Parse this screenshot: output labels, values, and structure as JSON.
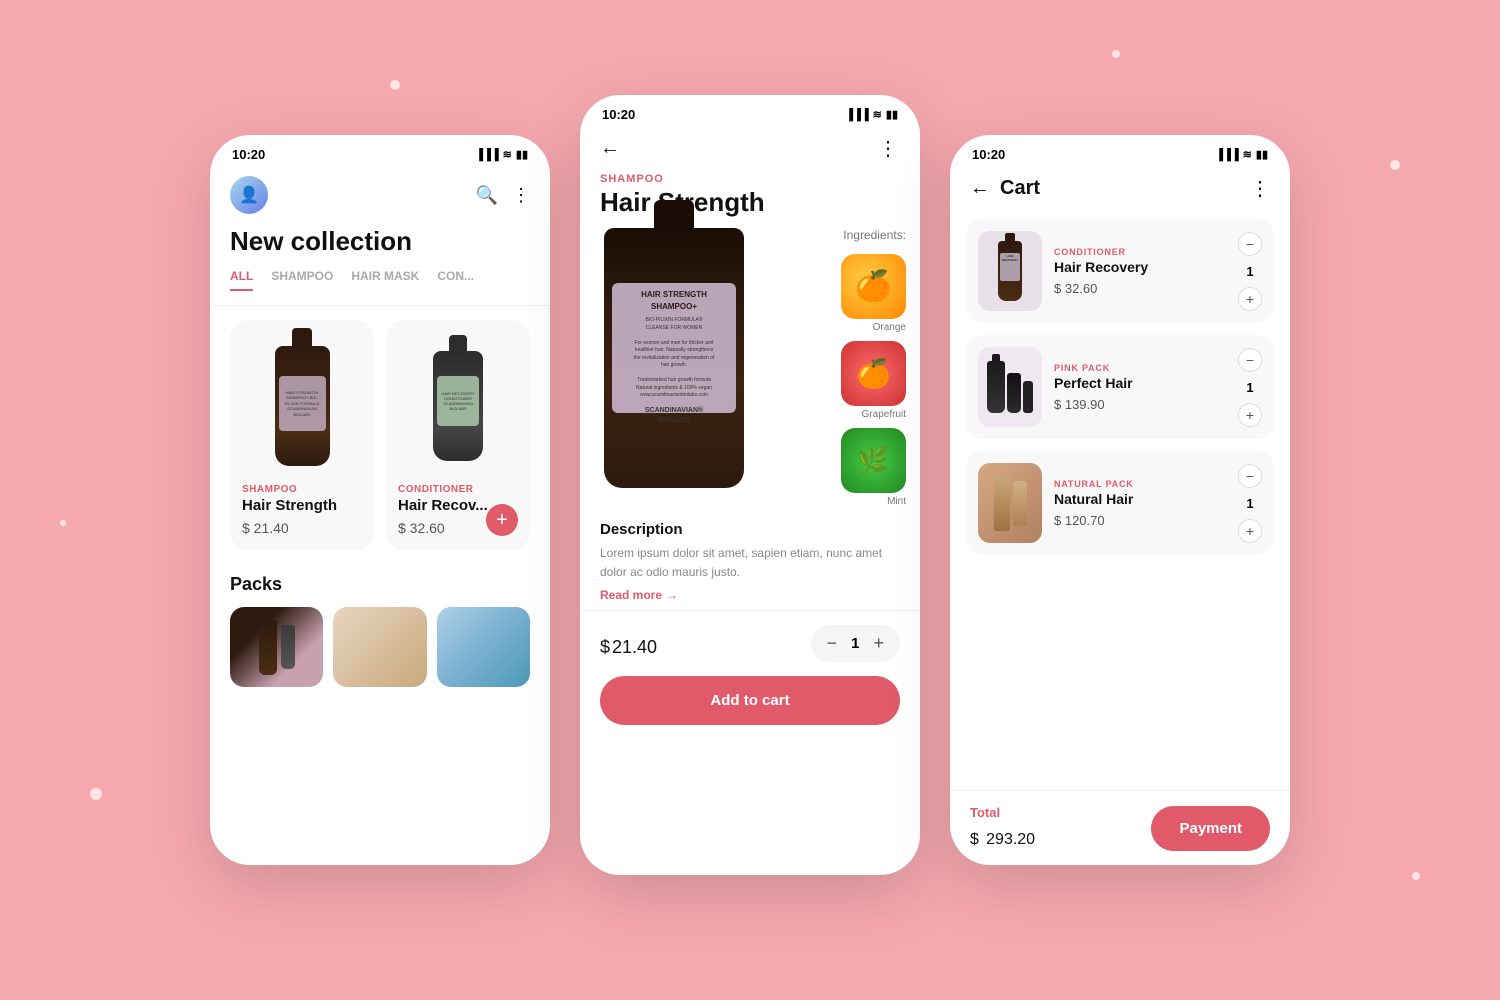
{
  "background": "#f5a8ae",
  "phones": {
    "left": {
      "status": {
        "time": "10:20",
        "icons": "▐▐▐ ≋ ▮▮"
      },
      "header": {
        "search_label": "🔍",
        "menu_label": "⋮"
      },
      "title": "New collection",
      "categories": [
        "ALL",
        "SHAMPOO",
        "HAIR MASK",
        "CON..."
      ],
      "active_category": "ALL",
      "products": [
        {
          "category": "SHAMPOO",
          "name": "Hair Strength",
          "price": "$ 21.40"
        },
        {
          "category": "CONDITIONER",
          "name": "Hair Recov...",
          "price": "$ 32.60"
        }
      ],
      "packs_title": "Packs"
    },
    "center": {
      "status": {
        "time": "10:20",
        "icons": "▐▐▐ ≋ ▮▮"
      },
      "product_category": "SHAMPOO",
      "product_name": "Hair Strength",
      "ingredients_label": "Ingredients:",
      "ingredients": [
        "Orange",
        "Grapefruit",
        "Mint"
      ],
      "description_title": "Description",
      "description_text": "Lorem ipsum dolor sit amet, sapien etiam, nunc amet dolor ac odio mauris justo.",
      "read_more": "Read more",
      "price": "$ 21.40",
      "price_symbol": "$",
      "price_value": "21.40",
      "quantity": 1,
      "add_to_cart_label": "Add to cart"
    },
    "right": {
      "status": {
        "time": "10:20",
        "icons": "▐▐▐ ≋ ▮▮"
      },
      "title": "Cart",
      "items": [
        {
          "category": "CONDITIONER",
          "name": "Hair Recovery",
          "price": "$ 32.60",
          "qty": 1
        },
        {
          "category": "PINK PACK",
          "name": "Perfect Hair",
          "price": "$ 139.90",
          "qty": 1
        },
        {
          "category": "NATURAL PACK",
          "name": "Natural Hair",
          "price": "$ 120.70",
          "qty": 1
        }
      ],
      "total_label": "Total",
      "total_symbol": "$",
      "total_amount": "293.20",
      "payment_label": "Payment"
    }
  }
}
